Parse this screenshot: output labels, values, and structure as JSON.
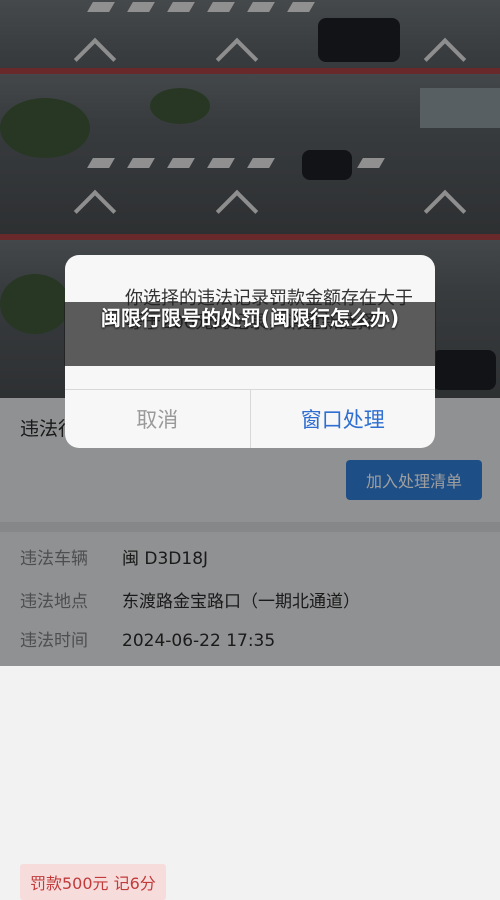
{
  "overlay": {
    "title": "闽限行限号的处罚(闽限行怎么办)"
  },
  "modal": {
    "message": "你选择的违法记录罚款金额存在大于等于200元的记录，请重新选择",
    "cancel_label": "取消",
    "confirm_label": "窗口处理"
  },
  "detail": {
    "heading": "违法行为",
    "fine_tag": "罚款500元  记6分",
    "add_button": "加入处理清单",
    "rows": [
      {
        "key": "违法车辆",
        "value": "闽 D3D18J"
      },
      {
        "key": "违法地点",
        "value": "东渡路金宝路口（一期北通道）"
      },
      {
        "key": "违法时间",
        "value": "2024-06-22 17:35"
      }
    ]
  },
  "colors": {
    "accent_blue": "#2f7fd8",
    "fine_red": "#c23a3a"
  }
}
